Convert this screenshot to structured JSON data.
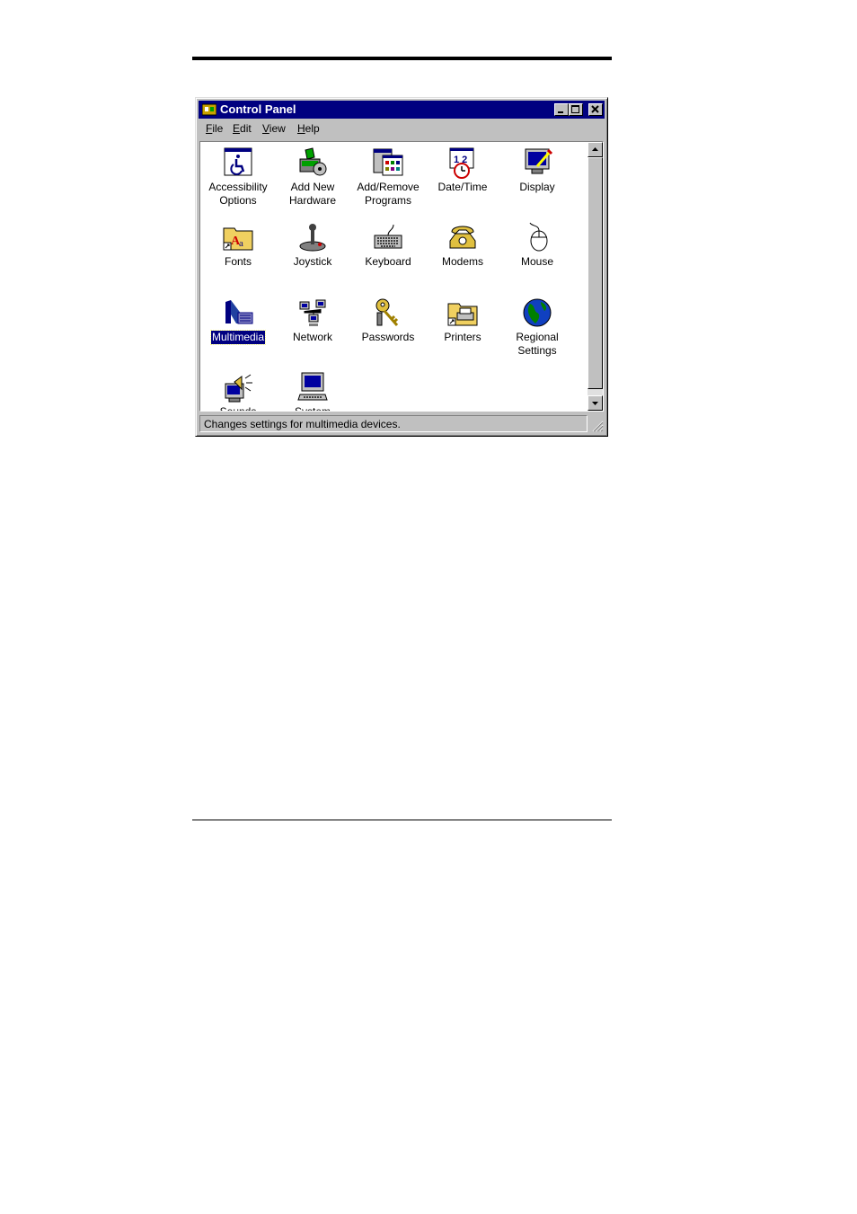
{
  "window": {
    "title": "Control Panel",
    "title_icon": "control-panel-icon",
    "buttons": [
      "minimize",
      "maximize",
      "close"
    ]
  },
  "menu": [
    {
      "label": "File",
      "mnemonic": "F"
    },
    {
      "label": "Edit",
      "mnemonic": "E"
    },
    {
      "label": "View",
      "mnemonic": "V"
    },
    {
      "label": "Help",
      "mnemonic": "H"
    }
  ],
  "items": [
    {
      "label": "Accessibility Options",
      "icon": "accessibility-icon"
    },
    {
      "label": "Add New Hardware",
      "icon": "hardware-icon"
    },
    {
      "label": "Add/Remove Programs",
      "icon": "programs-icon"
    },
    {
      "label": "Date/Time",
      "icon": "calendar-clock-icon"
    },
    {
      "label": "Display",
      "icon": "monitor-icon"
    },
    {
      "label": "Fonts",
      "icon": "fonts-folder-icon"
    },
    {
      "label": "Joystick",
      "icon": "joystick-icon"
    },
    {
      "label": "Keyboard",
      "icon": "keyboard-icon"
    },
    {
      "label": "Modems",
      "icon": "telephone-icon"
    },
    {
      "label": "Mouse",
      "icon": "mouse-icon"
    },
    {
      "label": "Multimedia",
      "icon": "multimedia-icon",
      "selected": true
    },
    {
      "label": "Network",
      "icon": "network-icon"
    },
    {
      "label": "Passwords",
      "icon": "keys-icon"
    },
    {
      "label": "Printers",
      "icon": "printers-folder-icon"
    },
    {
      "label": "Regional Settings",
      "icon": "globe-icon"
    },
    {
      "label": "Sounds",
      "icon": "speaker-icon"
    },
    {
      "label": "System",
      "icon": "computer-icon"
    }
  ],
  "status": "Changes settings for multimedia devices."
}
